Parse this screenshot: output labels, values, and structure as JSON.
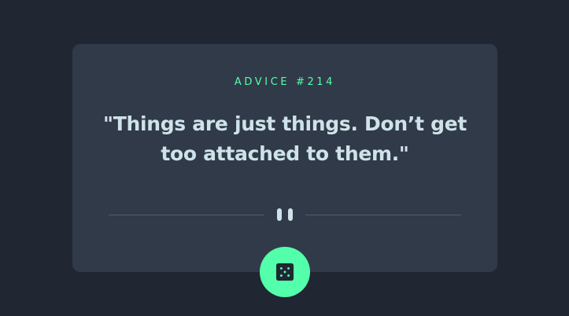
{
  "advice": {
    "id_label": "ADVICE #214",
    "quote": "\"Things are just things. Don’t get too attached to them.\""
  },
  "icons": {
    "divider": "pause-icon",
    "button": "dice-icon"
  },
  "colors": {
    "background": "#202632",
    "card": "#313a48",
    "accent": "#53ffaa",
    "text": "#cee3e9",
    "divider": "#4f5d74"
  }
}
